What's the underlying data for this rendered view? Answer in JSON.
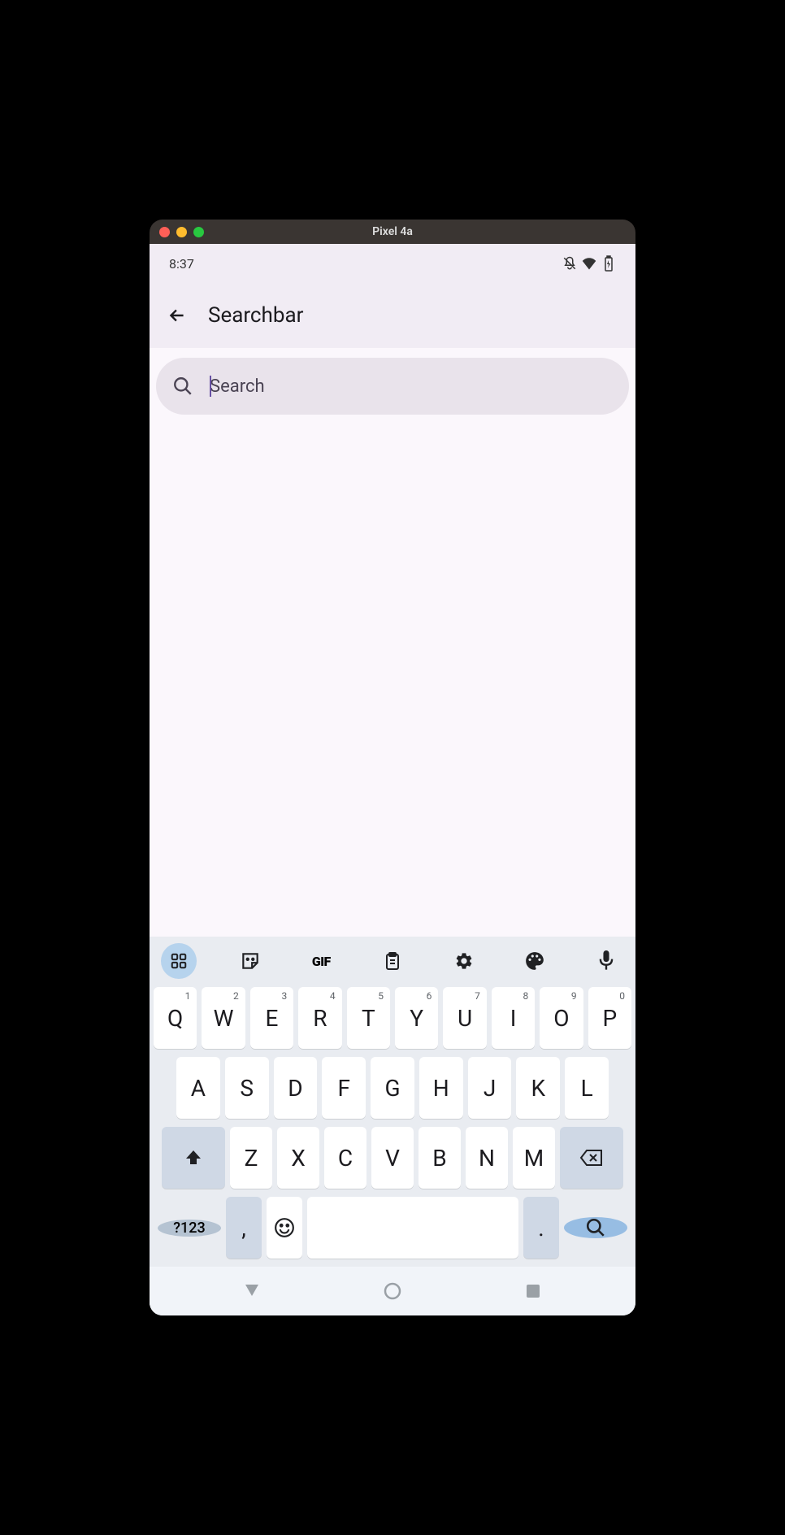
{
  "window": {
    "title": "Pixel 4a"
  },
  "status_bar": {
    "time": "8:37"
  },
  "header": {
    "title": "Searchbar"
  },
  "search": {
    "placeholder": "Search",
    "value": ""
  },
  "keyboard": {
    "toolbar": {
      "gif_label": "GIF"
    },
    "row1": [
      {
        "key": "Q",
        "num": "1"
      },
      {
        "key": "W",
        "num": "2"
      },
      {
        "key": "E",
        "num": "3"
      },
      {
        "key": "R",
        "num": "4"
      },
      {
        "key": "T",
        "num": "5"
      },
      {
        "key": "Y",
        "num": "6"
      },
      {
        "key": "U",
        "num": "7"
      },
      {
        "key": "I",
        "num": "8"
      },
      {
        "key": "O",
        "num": "9"
      },
      {
        "key": "P",
        "num": "0"
      }
    ],
    "row2": [
      "A",
      "S",
      "D",
      "F",
      "G",
      "H",
      "J",
      "K",
      "L"
    ],
    "row3": [
      "Z",
      "X",
      "C",
      "V",
      "B",
      "N",
      "M"
    ],
    "bottom": {
      "symbols_label": "?123",
      "comma": ",",
      "period": "."
    }
  }
}
